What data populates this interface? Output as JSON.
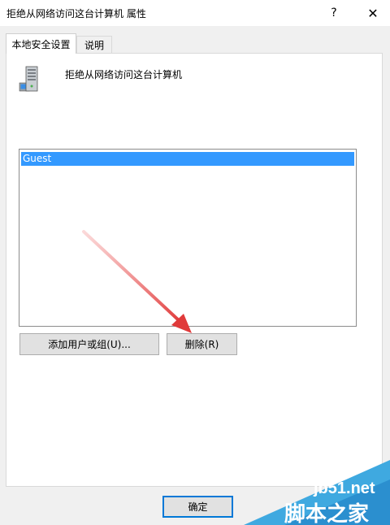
{
  "window": {
    "title": "拒绝从网络访问这台计算机 属性",
    "help_glyph": "?",
    "close_glyph": "✕"
  },
  "tabs": [
    {
      "label": "本地安全设置",
      "active": true
    },
    {
      "label": "说明",
      "active": false
    }
  ],
  "policy": {
    "icon": "server-computer-icon",
    "title": "拒绝从网络访问这台计算机"
  },
  "accounts": [
    {
      "name": "Guest",
      "selected": true
    }
  ],
  "buttons": {
    "add_label": "添加用户或组(U)...",
    "remove_label": "删除(R)",
    "ok_label": "确定"
  },
  "annotation": {
    "arrow_color": "#e03a3a",
    "points_to": "remove-button"
  },
  "watermark": {
    "site": "jb51.net",
    "name": "脚本之家",
    "color": "#3fa9e0"
  }
}
